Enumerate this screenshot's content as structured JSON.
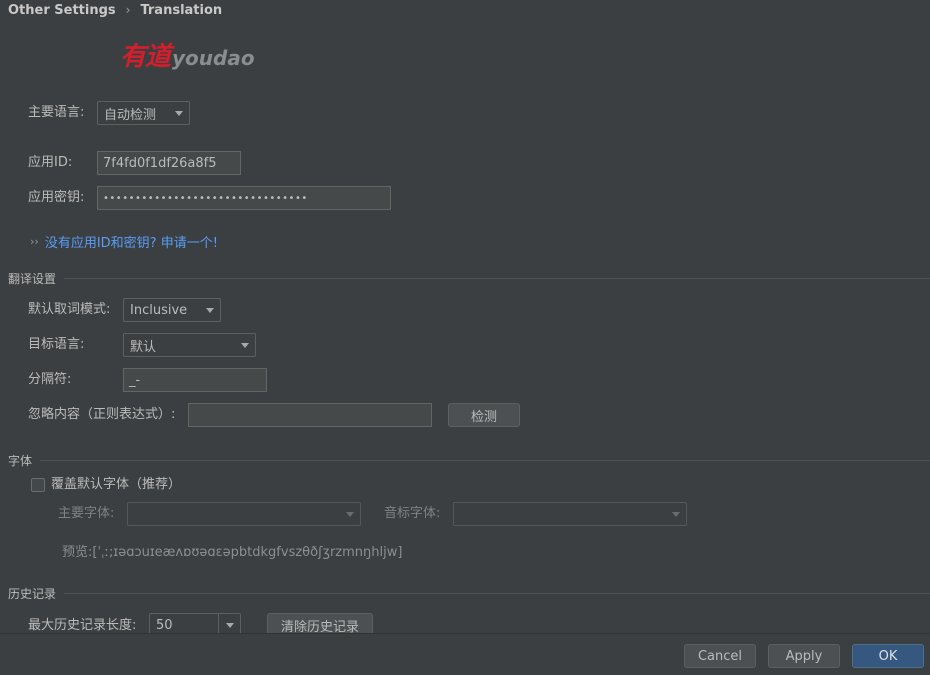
{
  "breadcrumb": {
    "parent": "Other Settings",
    "separator": "›",
    "current": "Translation"
  },
  "logo": {
    "cn": "有道",
    "en": "youdao"
  },
  "primary_language": {
    "label": "主要语言:",
    "value": "自动检测"
  },
  "app_id": {
    "label": "应用ID:",
    "value": "7f4fd0f1df26a8f5"
  },
  "app_key": {
    "label": "应用密钥:",
    "value": "••••••••••••••••••••••••••••••••"
  },
  "apply_link": {
    "chevron": "››",
    "text": "没有应用ID和密钥? 申请一个!"
  },
  "translation_settings": {
    "title": "翻译设置",
    "word_mode": {
      "label": "默认取词模式:",
      "value": "Inclusive"
    },
    "target_language": {
      "label": "目标语言:",
      "value": "默认"
    },
    "separator": {
      "label": "分隔符:",
      "value": "_-"
    },
    "ignore": {
      "label": "忽略内容（正则表达式）:",
      "value": "",
      "button": "检测"
    }
  },
  "font_section": {
    "title": "字体",
    "override_label": "覆盖默认字体（推荐）",
    "override_checked": false,
    "primary_font_label": "主要字体:",
    "phonetic_font_label": "音标字体:",
    "preview": "预览:[ˈˌː;ɪəɑɔuɪeæʌɒʊəɑɛəpbtdkgfvszθðʃʒrzmnŋhljw]"
  },
  "history": {
    "title": "历史记录",
    "max_length_label": "最大历史记录长度:",
    "max_length_value": "50",
    "clear_button": "清除历史记录"
  },
  "footer": {
    "cancel": "Cancel",
    "apply": "Apply",
    "ok": "OK"
  },
  "colors": {
    "background": "#3c3f41",
    "link": "#589df6",
    "primary_button": "#365880",
    "logo_red": "#d11f2c"
  }
}
